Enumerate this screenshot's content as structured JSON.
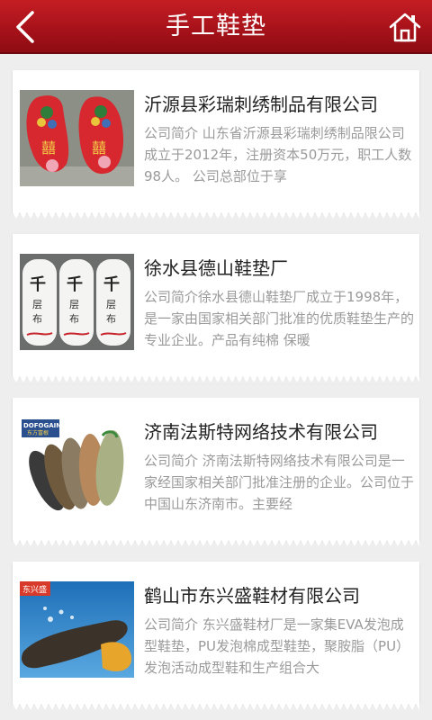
{
  "header": {
    "title": "手工鞋垫",
    "back_icon": "back-arrow-icon",
    "home_icon": "home-icon",
    "bg_color": "#b0161d"
  },
  "companies": [
    {
      "name": "沂源县彩瑞刺绣制品有限公司",
      "desc": "公司简介 山东省沂源县彩瑞刺绣制品限公司成立于2012年，注册资本50万元，职工人数98人。 公司总部位于享"
    },
    {
      "name": "徐水县德山鞋垫厂",
      "desc": "公司简介徐水县德山鞋垫厂成立于1998年，是一家由国家相关部门批准的优质鞋垫生产的专业企业。产品有纯棉 保暖"
    },
    {
      "name": "济南法斯特网络技术有限公司",
      "desc": "公司简介 济南法斯特网络技术有限公司是一家经国家相关部门批准注册的企业。公司位于中国山东济南市。主要经"
    },
    {
      "name": "鹤山市东兴盛鞋材有限公司",
      "desc": "公司简介 东兴盛鞋材厂是一家集EVA发泡成型鞋垫，PU发泡棉成型鞋垫，聚胺脂（PU）发泡活动成型鞋和生产组合大"
    }
  ],
  "thumb_labels": {
    "c3_brand": "DOFOGAIN",
    "c3_brand_sub": "东方富根",
    "c4_brand": "东兴盛"
  }
}
